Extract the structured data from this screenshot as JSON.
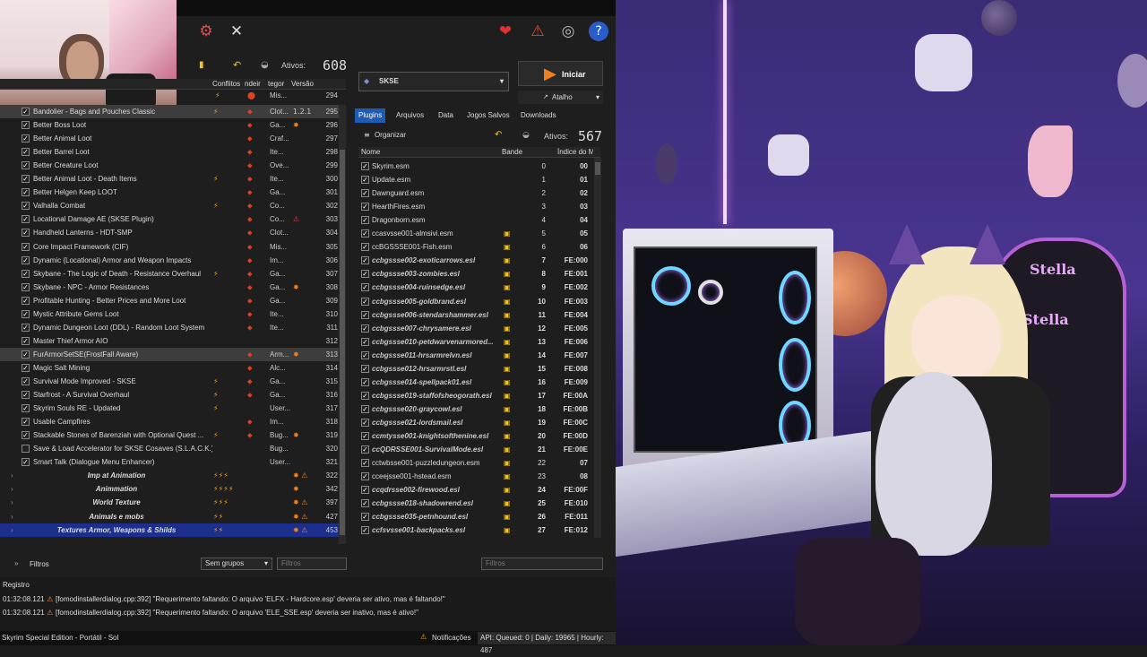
{
  "mo2": {
    "active_mods_label": "Ativos:",
    "active_mods_count": "608",
    "columns": {
      "conflicts": "Conflitos",
      "indicators": "ndeir",
      "category": "tegor",
      "version": "Versão"
    },
    "top_partial_row": {
      "flags": "⚡",
      "category": "Mis...",
      "priority": "294"
    },
    "mods": [
      {
        "name": "Bandolier - Bags and Pouches Classic",
        "flag": "⚡",
        "ind": "🔥",
        "cat": "Clot...",
        "ver": "1.2.1",
        "pri": "295",
        "checked": true,
        "sel": true
      },
      {
        "name": "Better Boss Loot",
        "flag": "",
        "ind": "🔥",
        "cat": "Ga...",
        "conf": "✸",
        "pri": "296",
        "checked": true
      },
      {
        "name": "Better Animal Loot",
        "flag": "",
        "ind": "🔥",
        "cat": "Craf...",
        "pri": "297",
        "checked": true
      },
      {
        "name": "Better Barrel Loot",
        "flag": "",
        "ind": "🔥",
        "cat": "Ite...",
        "pri": "298",
        "checked": true
      },
      {
        "name": "Better Creature Loot",
        "flag": "",
        "ind": "🔥",
        "cat": "Ove...",
        "pri": "299",
        "checked": true
      },
      {
        "name": "Better Animal Loot - Death Items",
        "flag": "⚡",
        "ind": "🔥",
        "cat": "Ite...",
        "pri": "300",
        "checked": true
      },
      {
        "name": "Better Helgen Keep LOOT",
        "flag": "",
        "ind": "🔥",
        "cat": "Ga...",
        "pri": "301",
        "checked": true
      },
      {
        "name": "Valhalla Combat",
        "flag": "⚡",
        "ind": "🔥",
        "cat": "Co...",
        "pri": "302",
        "checked": true
      },
      {
        "name": "Locational Damage AE (SKSE Plugin)",
        "flag": "",
        "ind": "🔥",
        "cat": "Co...",
        "conf": "⚠",
        "pri": "303",
        "checked": true
      },
      {
        "name": "Handheld Lanterns - HDT-SMP",
        "flag": "",
        "ind": "🔥",
        "cat": "Clot...",
        "pri": "304",
        "checked": true
      },
      {
        "name": "Core Impact Framework (CIF)",
        "flag": "",
        "ind": "🔥",
        "cat": "Mis...",
        "pri": "305",
        "checked": true
      },
      {
        "name": "Dynamic (Locational) Armor and Weapon Impacts",
        "flag": "",
        "ind": "🔥",
        "cat": "Im...",
        "pri": "306",
        "checked": true
      },
      {
        "name": "Skybane - The Logic of Death - Resistance Overhaul",
        "flag": "⚡",
        "ind": "🔥",
        "cat": "Ga...",
        "pri": "307",
        "checked": true
      },
      {
        "name": "Skybane - NPC - Armor Resistances",
        "flag": "",
        "ind": "🔥",
        "cat": "Ga...",
        "conf": "✸",
        "pri": "308",
        "checked": true
      },
      {
        "name": "Profitable Hunting - Better Prices and More Loot",
        "flag": "",
        "ind": "🔥",
        "cat": "Ga...",
        "pri": "309",
        "checked": true
      },
      {
        "name": "Mystic Attribute Gems Loot",
        "flag": "",
        "ind": "🔥",
        "cat": "Ite...",
        "pri": "310",
        "checked": true
      },
      {
        "name": "Dynamic Dungeon Loot (DDL) - Random Loot System",
        "flag": "",
        "ind": "🔥",
        "cat": "Ite...",
        "pri": "311",
        "checked": true
      },
      {
        "name": "Master Thief Armor AIO",
        "flag": "",
        "ind": "",
        "cat": "",
        "pri": "312",
        "checked": true
      },
      {
        "name": "FurArmorSetSE(FrostFall Aware)",
        "flag": "",
        "ind": "🔥",
        "cat": "Arm...",
        "conf": "✸",
        "pri": "313",
        "checked": true,
        "sel": true
      },
      {
        "name": "Magic Salt Mining",
        "flag": "",
        "ind": "🔥",
        "cat": "Alc...",
        "pri": "314",
        "checked": true
      },
      {
        "name": "Survival Mode Improved - SKSE",
        "flag": "⚡",
        "ind": "🔥",
        "cat": "Ga...",
        "pri": "315",
        "checked": true
      },
      {
        "name": "Starfrost - A Survival Overhaul",
        "flag": "⚡",
        "ind": "🔥",
        "cat": "Ga...",
        "pri": "316",
        "checked": true
      },
      {
        "name": "Skyrim Souls RE - Updated",
        "flag": "⚡",
        "ind": "",
        "cat": "User...",
        "pri": "317",
        "checked": true
      },
      {
        "name": "Usable Campfires",
        "flag": "",
        "ind": "🔥",
        "cat": "Im...",
        "pri": "318",
        "checked": true
      },
      {
        "name": "Stackable Stones of Barenziah with Optional Quest ...",
        "flag": "⚡",
        "ind": "🔥",
        "cat": "Bug...",
        "conf": "✸",
        "pri": "319",
        "checked": true
      },
      {
        "name": "Save & Load Accelerator for SKSE Cosaves (S.L.A.C.K.)",
        "flag": "",
        "ind": "",
        "cat": "Bug...",
        "pri": "320",
        "checked": false
      },
      {
        "name": "Smart Talk (Dialogue Menu Enhancer)",
        "flag": "",
        "ind": "",
        "cat": "User...",
        "pri": "321",
        "checked": true
      }
    ],
    "separators": [
      {
        "name": "Imp at Animation",
        "flag": "⚡⚡⚡",
        "conf": "✸ ⚠",
        "pri": "322"
      },
      {
        "name": "Animmation",
        "flag": "⚡⚡⚡⚡",
        "conf": "✸",
        "pri": "342"
      },
      {
        "name": "World Texture",
        "flag": "⚡⚡⚡",
        "conf": "✸ ⚠",
        "pri": "397"
      },
      {
        "name": "Animals e mobs",
        "flag": "⚡⚡",
        "conf": "✸ ⚠",
        "pri": "427"
      },
      {
        "name": "Textures Armor, Weapons & Shilds",
        "flag": "⚡⚡",
        "conf": "✸ ⚠",
        "pri": "453",
        "sel": true
      }
    ],
    "filters_label": "Filtros",
    "group_combo": "Sem grupos",
    "filter_placeholder": "Filtros",
    "executable": "SKSE",
    "launch_label": "Iniciar",
    "shortcut_label": "Atalho",
    "tabs": [
      "Plugins",
      "Arquivos",
      "Data",
      "Jogos Salvos",
      "Downloads"
    ],
    "organize_label": "Organizar",
    "active_plugins_label": "Ativos:",
    "active_plugins_count": "567",
    "plugin_columns": {
      "name": "Nome",
      "flags": "Bande",
      "index": "Índice do M"
    },
    "plugins": [
      {
        "name": "Skyrim.esm",
        "idx": "0",
        "mod": "00",
        "it": false
      },
      {
        "name": "Update.esm",
        "idx": "1",
        "mod": "01",
        "it": false
      },
      {
        "name": "Dawnguard.esm",
        "idx": "2",
        "mod": "02",
        "it": false
      },
      {
        "name": "HearthFires.esm",
        "idx": "3",
        "mod": "03",
        "it": false
      },
      {
        "name": "Dragonborn.esm",
        "idx": "4",
        "mod": "04",
        "it": false
      },
      {
        "name": "ccasvsse001-almsivi.esm",
        "idx": "5",
        "mod": "05",
        "it": false
      },
      {
        "name": "ccBGSSSE001-Fish.esm",
        "idx": "6",
        "mod": "06",
        "it": false
      },
      {
        "name": "ccbgssse002-exoticarrows.esl",
        "idx": "7",
        "mod": "FE:000",
        "it": true
      },
      {
        "name": "ccbgssse003-zombies.esl",
        "idx": "8",
        "mod": "FE:001",
        "it": true
      },
      {
        "name": "ccbgssse004-ruinsedge.esl",
        "idx": "9",
        "mod": "FE:002",
        "it": true
      },
      {
        "name": "ccbgssse005-goldbrand.esl",
        "idx": "10",
        "mod": "FE:003",
        "it": true
      },
      {
        "name": "ccbgssse006-stendarshammer.esl",
        "idx": "11",
        "mod": "FE:004",
        "it": true
      },
      {
        "name": "ccbgssse007-chrysamere.esl",
        "idx": "12",
        "mod": "FE:005",
        "it": true
      },
      {
        "name": "ccbgssse010-petdwarvenarmored...",
        "idx": "13",
        "mod": "FE:006",
        "it": true
      },
      {
        "name": "ccbgssse011-hrsarmrelvn.esl",
        "idx": "14",
        "mod": "FE:007",
        "it": true
      },
      {
        "name": "ccbgssse012-hrsarmrstl.esl",
        "idx": "15",
        "mod": "FE:008",
        "it": true
      },
      {
        "name": "ccbgssse014-spellpack01.esl",
        "idx": "16",
        "mod": "FE:009",
        "it": true
      },
      {
        "name": "ccbgssse019-staffofsheogorath.esl",
        "idx": "17",
        "mod": "FE:00A",
        "it": true
      },
      {
        "name": "ccbgssse020-graycowl.esl",
        "idx": "18",
        "mod": "FE:00B",
        "it": true
      },
      {
        "name": "ccbgssse021-lordsmail.esl",
        "idx": "19",
        "mod": "FE:00C",
        "it": true
      },
      {
        "name": "ccmtysse001-knightsofthenine.esl",
        "idx": "20",
        "mod": "FE:00D",
        "it": true
      },
      {
        "name": "ccQDRSSE001-SurvivalMode.esl",
        "idx": "21",
        "mod": "FE:00E",
        "it": true
      },
      {
        "name": "cctwbsse001-puzzledungeon.esm",
        "idx": "22",
        "mod": "07",
        "it": false
      },
      {
        "name": "cceejsse001-hstead.esm",
        "idx": "23",
        "mod": "08",
        "it": false
      },
      {
        "name": "ccqdrsse002-firewood.esl",
        "idx": "24",
        "mod": "FE:00F",
        "it": true
      },
      {
        "name": "ccbgssse018-shadowrend.esl",
        "idx": "25",
        "mod": "FE:010",
        "it": true
      },
      {
        "name": "ccbgssse035-petnhound.esl",
        "idx": "26",
        "mod": "FE:011",
        "it": true
      },
      {
        "name": "ccfsvsse001-backpacks.esl",
        "idx": "27",
        "mod": "FE:012",
        "it": true
      }
    ],
    "plugin_filter_placeholder": "Filtros",
    "log_title": "Registro",
    "log": [
      {
        "time": "01:32:08.121",
        "text": "[fomodinstallerdialog.cpp:392] \"Requerimento faltando: O arquivo 'ELFX - Hardcore.esp' deveria ser ativo, mas é faltando!\""
      },
      {
        "time": "01:32:08.121",
        "text": "[fomodinstallerdialog.cpp:392] \"Requerimento faltando: O arquivo 'ELE_SSE.esp' deveria ser inativo, mas é ativo!\""
      }
    ],
    "status_title": "Skyrim Special Edition - Portátil - Sol",
    "status_notifications": "Notificações",
    "status_api": "API: Queued: 0 | Daily: 19965 | Hourly: 487"
  },
  "stream": {
    "chair_text_1": "Stella",
    "chair_text_2": "Stella"
  },
  "colors": {
    "tab_active": "#1e5bb5",
    "selection": "#1d2f8c",
    "neon": "#d080ff"
  }
}
